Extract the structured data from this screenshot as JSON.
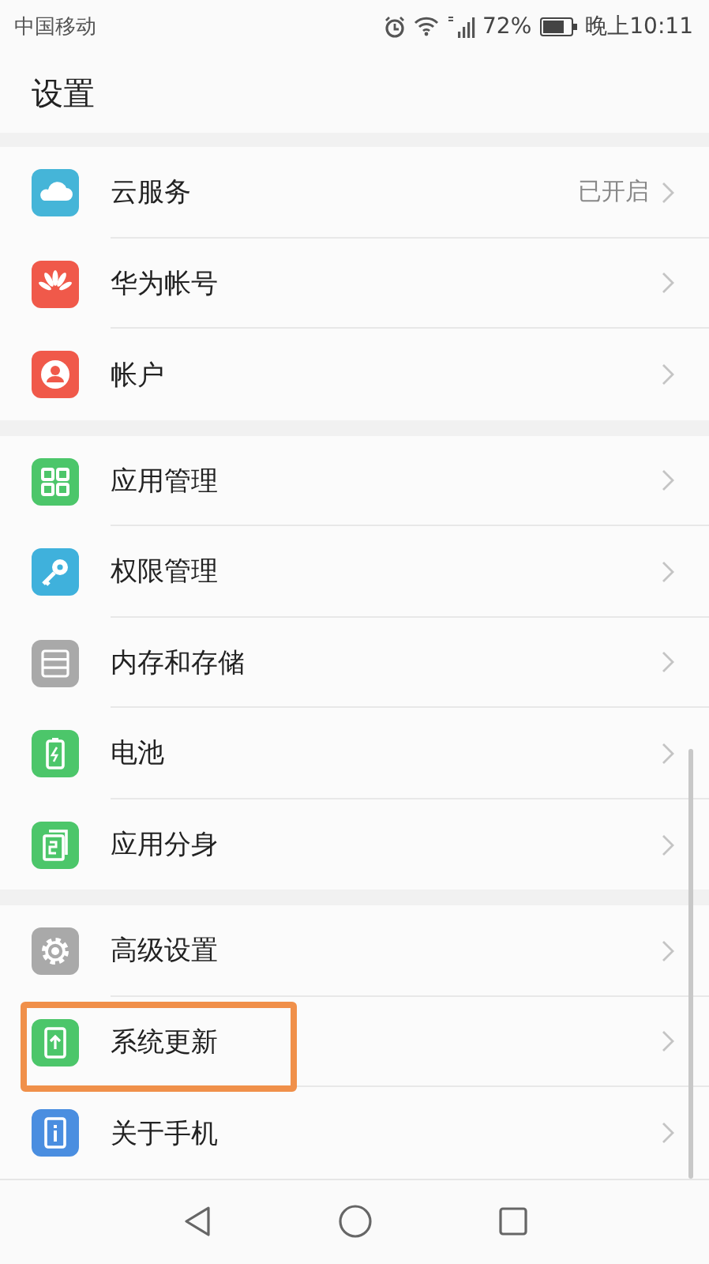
{
  "status_bar": {
    "carrier": "中国移动",
    "battery_percent": "72%",
    "time": "晚上10:11"
  },
  "title": "设置",
  "groups": [
    {
      "items": [
        {
          "kind": "cloud",
          "color": "#45b5d8",
          "label": "云服务",
          "value": "已开启",
          "highlighted": false
        },
        {
          "kind": "flower",
          "color": "#f0594a",
          "label": "华为帐号",
          "highlighted": false
        },
        {
          "kind": "person",
          "color": "#f0594a",
          "label": "帐户",
          "highlighted": false
        }
      ]
    },
    {
      "items": [
        {
          "kind": "grid",
          "color": "#4cc66a",
          "label": "应用管理",
          "highlighted": false
        },
        {
          "kind": "key",
          "color": "#3fb1dc",
          "label": "权限管理",
          "highlighted": false
        },
        {
          "kind": "storage",
          "color": "#a9a9a9",
          "label": "内存和存储",
          "highlighted": false
        },
        {
          "kind": "battery",
          "color": "#4cc66a",
          "label": "电池",
          "highlighted": false
        },
        {
          "kind": "twin",
          "color": "#4cc66a",
          "label": "应用分身",
          "highlighted": false
        }
      ]
    },
    {
      "items": [
        {
          "kind": "gear",
          "color": "#a9a9a9",
          "label": "高级设置",
          "highlighted": false
        },
        {
          "kind": "update",
          "color": "#4cc66a",
          "label": "系统更新",
          "highlighted": true
        },
        {
          "kind": "info",
          "color": "#4a8ee0",
          "label": "关于手机",
          "highlighted": false
        }
      ]
    }
  ]
}
